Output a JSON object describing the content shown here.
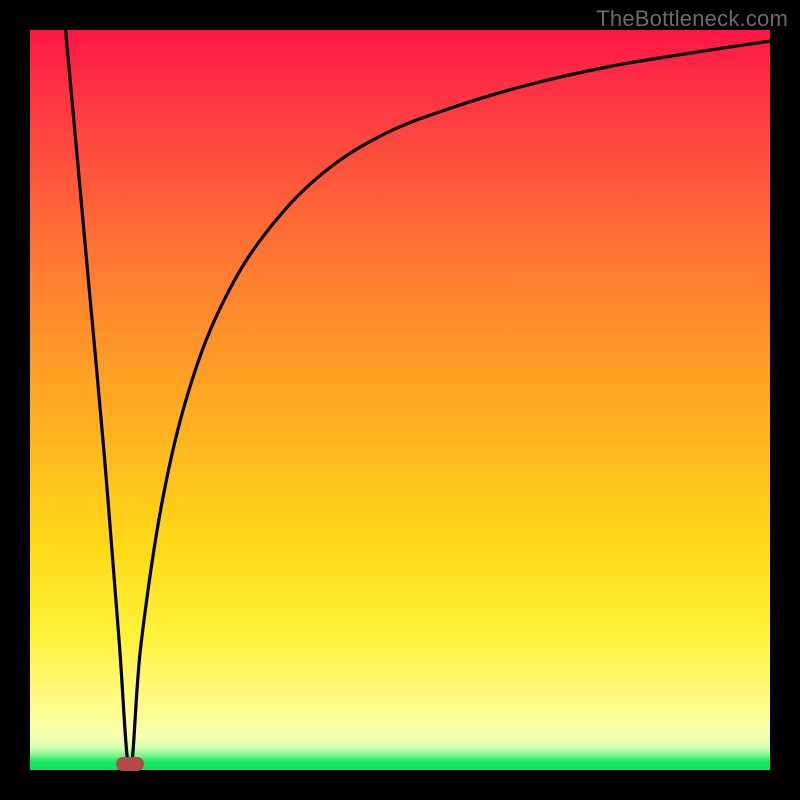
{
  "watermark": "TheBottleneck.com",
  "chart_data": {
    "type": "line",
    "title": "",
    "xlabel": "",
    "ylabel": "",
    "xlim": [
      0,
      1
    ],
    "ylim": [
      0,
      1
    ],
    "grid": false,
    "legend": false,
    "line_color": "#000000",
    "marker": {
      "x": 0.135,
      "y": 0.0,
      "color": "#b44a46"
    },
    "series": [
      {
        "name": "bottleneck-curve",
        "x": [
          0.048,
          0.06,
          0.08,
          0.1,
          0.12,
          0.135,
          0.15,
          0.18,
          0.22,
          0.27,
          0.33,
          0.4,
          0.48,
          0.57,
          0.67,
          0.78,
          0.9,
          1.0
        ],
        "y": [
          1.0,
          0.87,
          0.65,
          0.43,
          0.18,
          0.0,
          0.17,
          0.37,
          0.53,
          0.65,
          0.74,
          0.81,
          0.86,
          0.895,
          0.925,
          0.95,
          0.97,
          0.985
        ]
      }
    ]
  },
  "colors": {
    "frame_bg": "#000000",
    "gradient_top": "#ff1545",
    "gradient_bottom": "#12e05e"
  }
}
